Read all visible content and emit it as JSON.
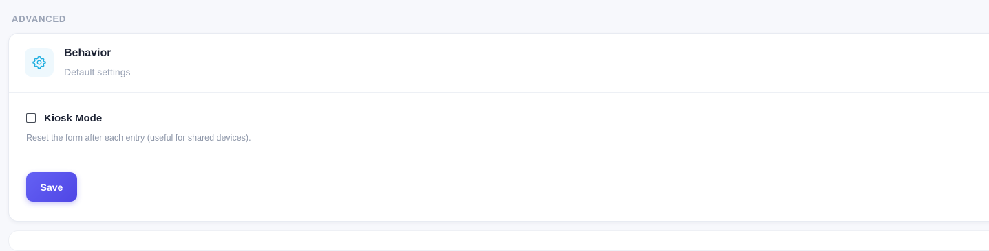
{
  "section": {
    "label": "ADVANCED"
  },
  "card": {
    "icon": "gear-icon",
    "title": "Behavior",
    "subtitle": "Default settings"
  },
  "kiosk": {
    "label": "Kiosk Mode",
    "checked": false,
    "help": "Reset the form after each entry (useful for shared devices)."
  },
  "actions": {
    "save_label": "Save"
  },
  "colors": {
    "accent": "#4f46e5",
    "icon": "#1eaee0",
    "icon_bg": "#eef8fd",
    "page_bg": "#f7f8fc"
  }
}
